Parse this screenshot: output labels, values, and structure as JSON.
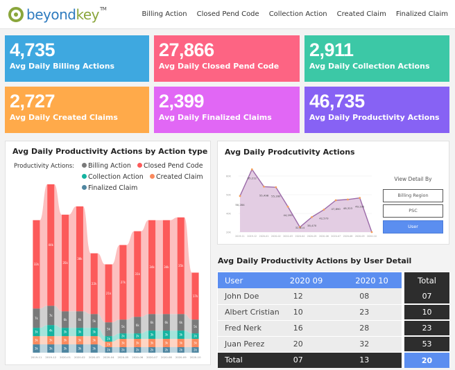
{
  "header": {
    "logo_left": "beyond",
    "logo_right": "key",
    "logo_tm": "TM",
    "nav": [
      "Billing Action",
      "Closed Pend Code",
      "Collection Action",
      "Created Claim",
      "Finalized Claim"
    ]
  },
  "kpis": [
    {
      "value": "4,735",
      "label": "Avg Daily Billing Actions",
      "color": "#3ea8e0"
    },
    {
      "value": "27,866",
      "label": "Avg Daily Closed Pend Code",
      "color": "#fd6483"
    },
    {
      "value": "2,911",
      "label": "Avg Daily Collection Actions",
      "color": "#3cc8a6"
    },
    {
      "value": "2,727",
      "label": "Avg Daily Created Claims",
      "color": "#ffaa4a"
    },
    {
      "value": "2,399",
      "label": "Avg Daily Finalized Claims",
      "color": "#e167f5"
    },
    {
      "value": "46,735",
      "label": "Avg Daily Productivity Actions",
      "color": "#8762f4"
    }
  ],
  "bar_card": {
    "title": "Avg Daily Productivity Actions by Action type",
    "legend_label": "Productivity Actions:"
  },
  "line_card": {
    "title": "Avg Daily Prodcutivity Actions",
    "view_detail_label": "View Detail By",
    "buttons": [
      "Billing Region",
      "PSC",
      "User"
    ],
    "active_button": "User"
  },
  "table_card": {
    "title": "Avg Daily Productivity Actions by User Detail",
    "headers": [
      "User",
      "2020  09",
      "2020  10",
      "Total"
    ],
    "rows": [
      [
        "John Doe",
        "12",
        "08",
        "07"
      ],
      [
        "Albert Cristian",
        "10",
        "23",
        "10"
      ],
      [
        "Fred Nerk",
        "16",
        "28",
        "23"
      ],
      [
        "Juan Perez",
        "20",
        "32",
        "53"
      ]
    ],
    "total_row": [
      "Total",
      "07",
      "13",
      "20"
    ]
  },
  "chart_data": [
    {
      "type": "bar",
      "stacked": true,
      "title": "Avg Daily Productivity Actions by Action type",
      "categories": [
        "2019-11",
        "2019-12",
        "2020-01",
        "2020-02",
        "2020-03",
        "2020-04",
        "2020-05",
        "2020-06",
        "2020-07",
        "2020-08",
        "2020-09",
        "2020-10"
      ],
      "series": [
        {
          "name": "Finalized Claim",
          "color": "#4f86a0",
          "values": [
            3,
            3,
            3,
            3,
            3,
            2,
            2,
            2,
            2,
            2,
            2,
            2
          ]
        },
        {
          "name": "Created Claim",
          "color": "#fa8a5e",
          "values": [
            3,
            3,
            3,
            3,
            3,
            2,
            3,
            3,
            3,
            3,
            3,
            3
          ]
        },
        {
          "name": "Collection Action",
          "color": "#14b3a0",
          "values": [
            3,
            4,
            3,
            3,
            3,
            2,
            2,
            2,
            3,
            3,
            3,
            2
          ]
        },
        {
          "name": "Billing Action",
          "color": "#7a7a7a",
          "values": [
            7,
            7,
            6,
            6,
            5,
            5,
            5,
            6,
            6,
            6,
            6,
            5
          ]
        },
        {
          "name": "Closed Pend Code",
          "color": "#fc5a5a",
          "values": [
            32,
            44,
            35,
            38,
            22,
            21,
            27,
            31,
            34,
            34,
            35,
            17
          ]
        }
      ],
      "legend": [
        "Billing Action",
        "Closed Pend Code",
        "Collection Action",
        "Created Claim",
        "Finalized Claim"
      ],
      "legend_position": "top-left"
    },
    {
      "type": "area",
      "title": "Avg Daily Prodcutivity Actions",
      "x": [
        "2019-11",
        "2019-12",
        "2020-01",
        "2020-02",
        "2020-03",
        "2020-04",
        "2020-05",
        "2020-06",
        "2020-07",
        "2020-08",
        "2020-09",
        "2020-10"
      ],
      "values": [
        50284,
        65212,
        55498,
        55160,
        44295,
        32814,
        38470,
        42573,
        47890,
        48323,
        49192,
        20000
      ],
      "labels": [
        "50,284",
        "65,212",
        "55,498",
        "55,160",
        "44,295",
        "32,814",
        "38,470",
        "42,573",
        "47,890",
        "48,323",
        "49,192",
        ""
      ],
      "ylim": [
        30000,
        65000
      ],
      "color": "#9b6aa8",
      "fill": "#e3cde3",
      "marker_color": "#f5a05a"
    }
  ]
}
